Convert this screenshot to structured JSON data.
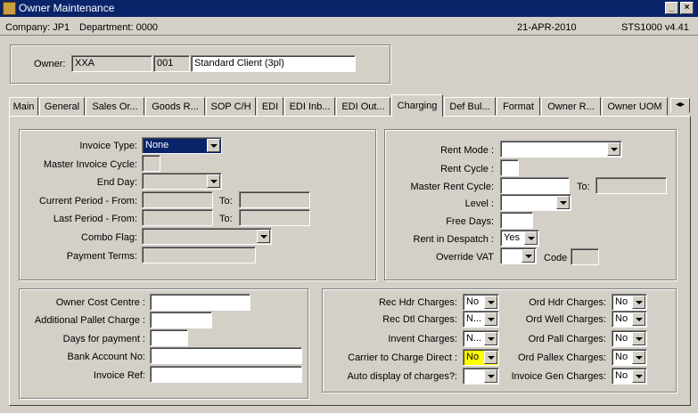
{
  "window": {
    "title": "Owner Maintenance"
  },
  "info": {
    "company": "Company:  JP1",
    "department": "Department:  0000",
    "date": "21-APR-2010",
    "version": "STS1000  v4.41"
  },
  "owner": {
    "label": "Owner:",
    "code": "XXA",
    "num": "001",
    "name": "Standard Client (3pl)"
  },
  "tabs": [
    "Main",
    "General",
    "Sales Or...",
    "Goods R...",
    "SOP C/H",
    "EDI",
    "EDI Inb...",
    "EDI Out...",
    "Charging",
    "Def Bul...",
    "Format",
    "Owner R...",
    "Owner UOM"
  ],
  "invoice": {
    "type_label": "Invoice Type:",
    "type_value": "None",
    "master_cycle_label": "Master Invoice Cycle:",
    "end_day_label": "End Day:",
    "current_period_label": "Current Period - From:",
    "to1": "To:",
    "last_period_label": "Last Period - From:",
    "to2": "To:",
    "combo_label": "Combo Flag:",
    "payment_label": "Payment Terms:"
  },
  "rent": {
    "mode_label": "Rent Mode :",
    "cycle_label": "Rent Cycle :",
    "master_label": "Master Rent Cycle:",
    "to": "To:",
    "level_label": "Level :",
    "free_label": "Free Days:",
    "despatch_label": "Rent in Despatch :",
    "despatch_value": "Yes",
    "vat_label": "Override VAT",
    "code_label": "Code"
  },
  "owner_cost": {
    "centre_label": "Owner Cost Centre :",
    "pallet_label": "Additional Pallet Charge :",
    "days_label": "Days for payment :",
    "bank_label": "Bank Account No:",
    "invoice_ref_label": "Invoice Ref:"
  },
  "charges": {
    "rec_hdr_label": "Rec Hdr Charges:",
    "rec_hdr_value": "No",
    "rec_dtl_label": "Rec Dtl Charges:",
    "rec_dtl_value": "N...",
    "invent_label": "Invent Charges:",
    "invent_value": "N...",
    "carrier_label": "Carrier to Charge Direct :",
    "carrier_value": "No",
    "auto_label": "Auto display of charges?:",
    "ord_hdr_label": "Ord Hdr Charges:",
    "ord_hdr_value": "No",
    "ord_well_label": "Ord Well Charges:",
    "ord_well_value": "No",
    "ord_pall_label": "Ord Pall Charges:",
    "ord_pall_value": "No",
    "ord_pallex_label": "Ord Pallex Charges:",
    "ord_pallex_value": "No",
    "inv_gen_label": "Invoice Gen Charges:",
    "inv_gen_value": "No"
  }
}
